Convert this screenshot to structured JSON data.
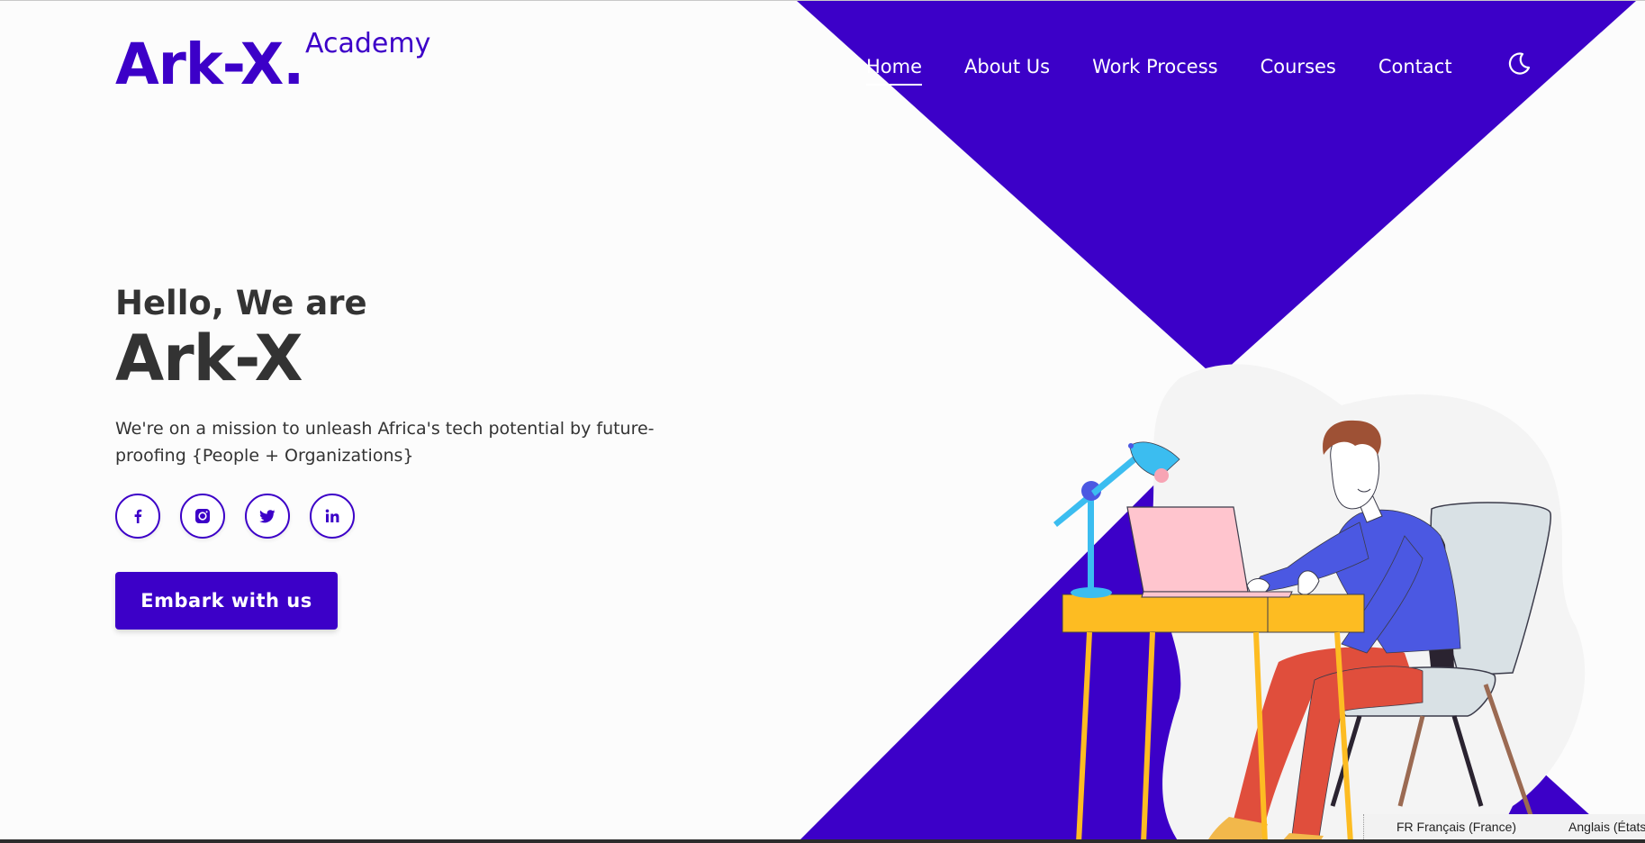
{
  "logo": {
    "main": "Ark-X.",
    "sub": "Academy"
  },
  "nav": {
    "items": [
      {
        "label": "Home",
        "active": true
      },
      {
        "label": "About Us",
        "active": false
      },
      {
        "label": "Work Process",
        "active": false
      },
      {
        "label": "Courses",
        "active": false
      },
      {
        "label": "Contact",
        "active": false
      }
    ],
    "theme_toggle_icon": "moon-icon"
  },
  "hero": {
    "greeting": "Hello, We are",
    "name": "Ark-X",
    "description": "We're on a mission to unleash Africa's tech potential by future-proofing {People + Organizations}"
  },
  "social": [
    {
      "icon": "facebook-icon"
    },
    {
      "icon": "instagram-icon"
    },
    {
      "icon": "twitter-icon"
    },
    {
      "icon": "linkedin-icon"
    }
  ],
  "cta": {
    "label": "Embark with us"
  },
  "language_bar": {
    "current": "FR Français (France)",
    "other": "Anglais (États"
  },
  "colors": {
    "brand": "#3c00c8",
    "text": "#333333",
    "background": "#fcfcfc"
  }
}
